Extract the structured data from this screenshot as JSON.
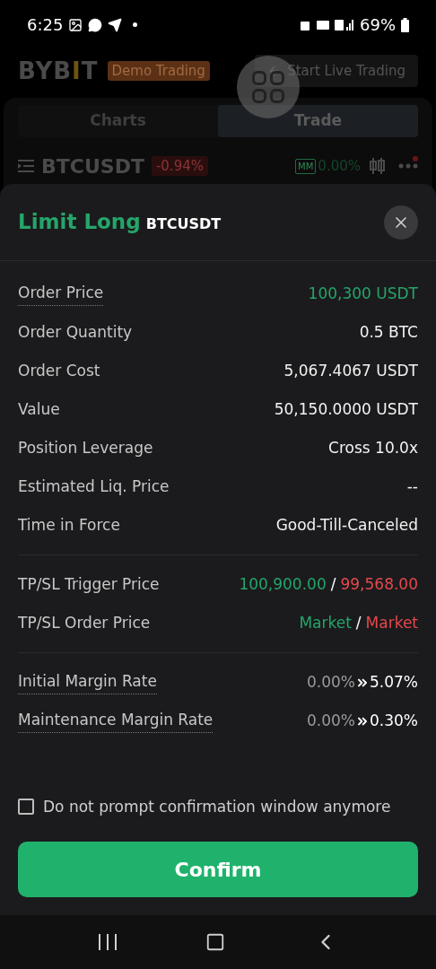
{
  "status_bar": {
    "time": "6:25",
    "battery": "69%"
  },
  "header": {
    "logo": "BYBIT",
    "badge": "Demo Trading",
    "live_button": "Start Live Trading"
  },
  "tabs": [
    {
      "label": "Charts",
      "selected": false
    },
    {
      "label": "Trade",
      "selected": true
    }
  ],
  "ticker": {
    "symbol": "BTCUSDT",
    "change": "-0.94%",
    "mm_label": "MM",
    "mm_value": "0.00%",
    "notification": true
  },
  "sheet": {
    "side": "Limit Long",
    "symbol": "BTCUSDT",
    "sections": [
      [
        {
          "label": "Order Price",
          "underlined": true,
          "kind": "plain",
          "value": "100,300 USDT",
          "color": "#25a56a"
        },
        {
          "label": "Order Quantity",
          "underlined": false,
          "kind": "plain",
          "value": "0.5 BTC",
          "color": "#f2f2f2"
        },
        {
          "label": "Order Cost",
          "underlined": false,
          "kind": "plain",
          "value": "5,067.4067 USDT",
          "color": "#f2f2f2"
        },
        {
          "label": "Value",
          "underlined": false,
          "kind": "plain",
          "value": "50,150.0000 USDT",
          "color": "#f2f2f2"
        },
        {
          "label": "Position Leverage",
          "underlined": false,
          "kind": "plain",
          "value": "Cross 10.0x",
          "color": "#f2f2f2"
        },
        {
          "label": "Estimated Liq. Price",
          "underlined": false,
          "kind": "plain",
          "value": "--",
          "color": "#f2f2f2"
        },
        {
          "label": "Time in Force",
          "underlined": false,
          "kind": "plain",
          "value": "Good-Till-Canceled",
          "color": "#f2f2f2"
        }
      ],
      [
        {
          "label": "TP/SL Trigger Price",
          "underlined": false,
          "kind": "split",
          "tp": "100,900.00",
          "separator": "/",
          "sl": "99,568.00"
        },
        {
          "label": "TP/SL Order Price",
          "underlined": false,
          "kind": "split",
          "tp": "Market",
          "separator": "/",
          "sl": "Market"
        }
      ],
      [
        {
          "label": "Initial Margin Rate",
          "underlined": true,
          "kind": "change",
          "from": "0.00%",
          "to": "5.07%"
        },
        {
          "label": "Maintenance Margin Rate",
          "underlined": true,
          "kind": "change",
          "from": "0.00%",
          "to": "0.30%"
        }
      ]
    ],
    "dont_prompt": {
      "label": "Do not prompt confirmation window anymore",
      "checked": false
    },
    "confirm": "Confirm"
  }
}
